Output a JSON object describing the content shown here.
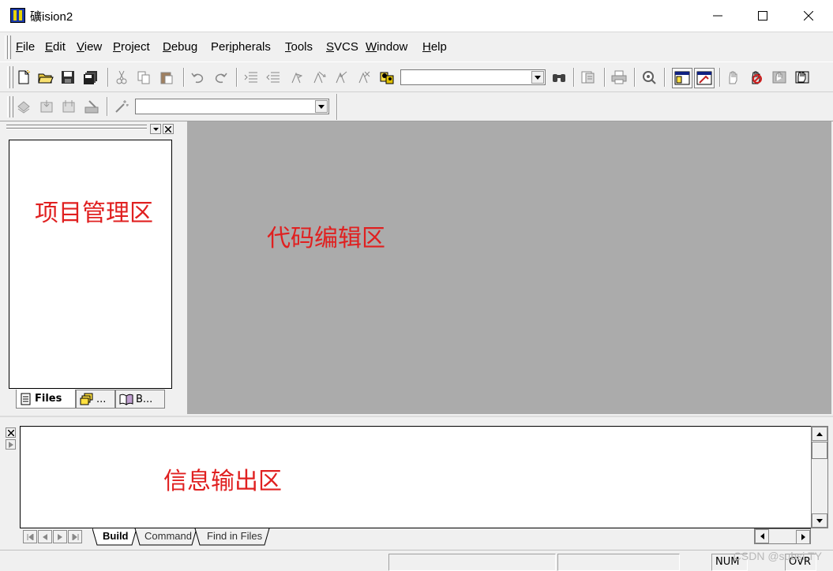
{
  "window": {
    "title": "礦ision2"
  },
  "menu": [
    {
      "label": "File",
      "u": "F",
      "rest": "ile"
    },
    {
      "label": "Edit",
      "u": "E",
      "rest": "dit"
    },
    {
      "label": "View",
      "u": "V",
      "rest": "iew"
    },
    {
      "label": "Project",
      "u": "P",
      "rest": "roject"
    },
    {
      "label": "Debug",
      "u": "D",
      "rest": "ebug"
    },
    {
      "label": "Peripherals",
      "pre": "Per",
      "u": "i",
      "rest": "pherals"
    },
    {
      "label": "Tools",
      "u": "T",
      "rest": "ools"
    },
    {
      "label": "SVCS",
      "u": "S",
      "rest": "VCS"
    },
    {
      "label": "Window",
      "u": "W",
      "rest": "indow"
    },
    {
      "label": "Help",
      "u": "H",
      "rest": "elp"
    }
  ],
  "annotations": {
    "project": "项目管理区",
    "editor": "代码编辑区",
    "output": "信息输出区"
  },
  "project_tabs": {
    "files": "Files",
    "regs": "...",
    "books": "B..."
  },
  "output_tabs": {
    "build": "Build",
    "command": "Command",
    "find": "Find in Files"
  },
  "status": {
    "num": "NUM",
    "ovr": "OVR"
  },
  "watermark": "CSDN @subsi.TY",
  "colors": {
    "annotation": "#e02020",
    "editor_bg": "#ababab",
    "chrome_bg": "#f0f0f0"
  }
}
